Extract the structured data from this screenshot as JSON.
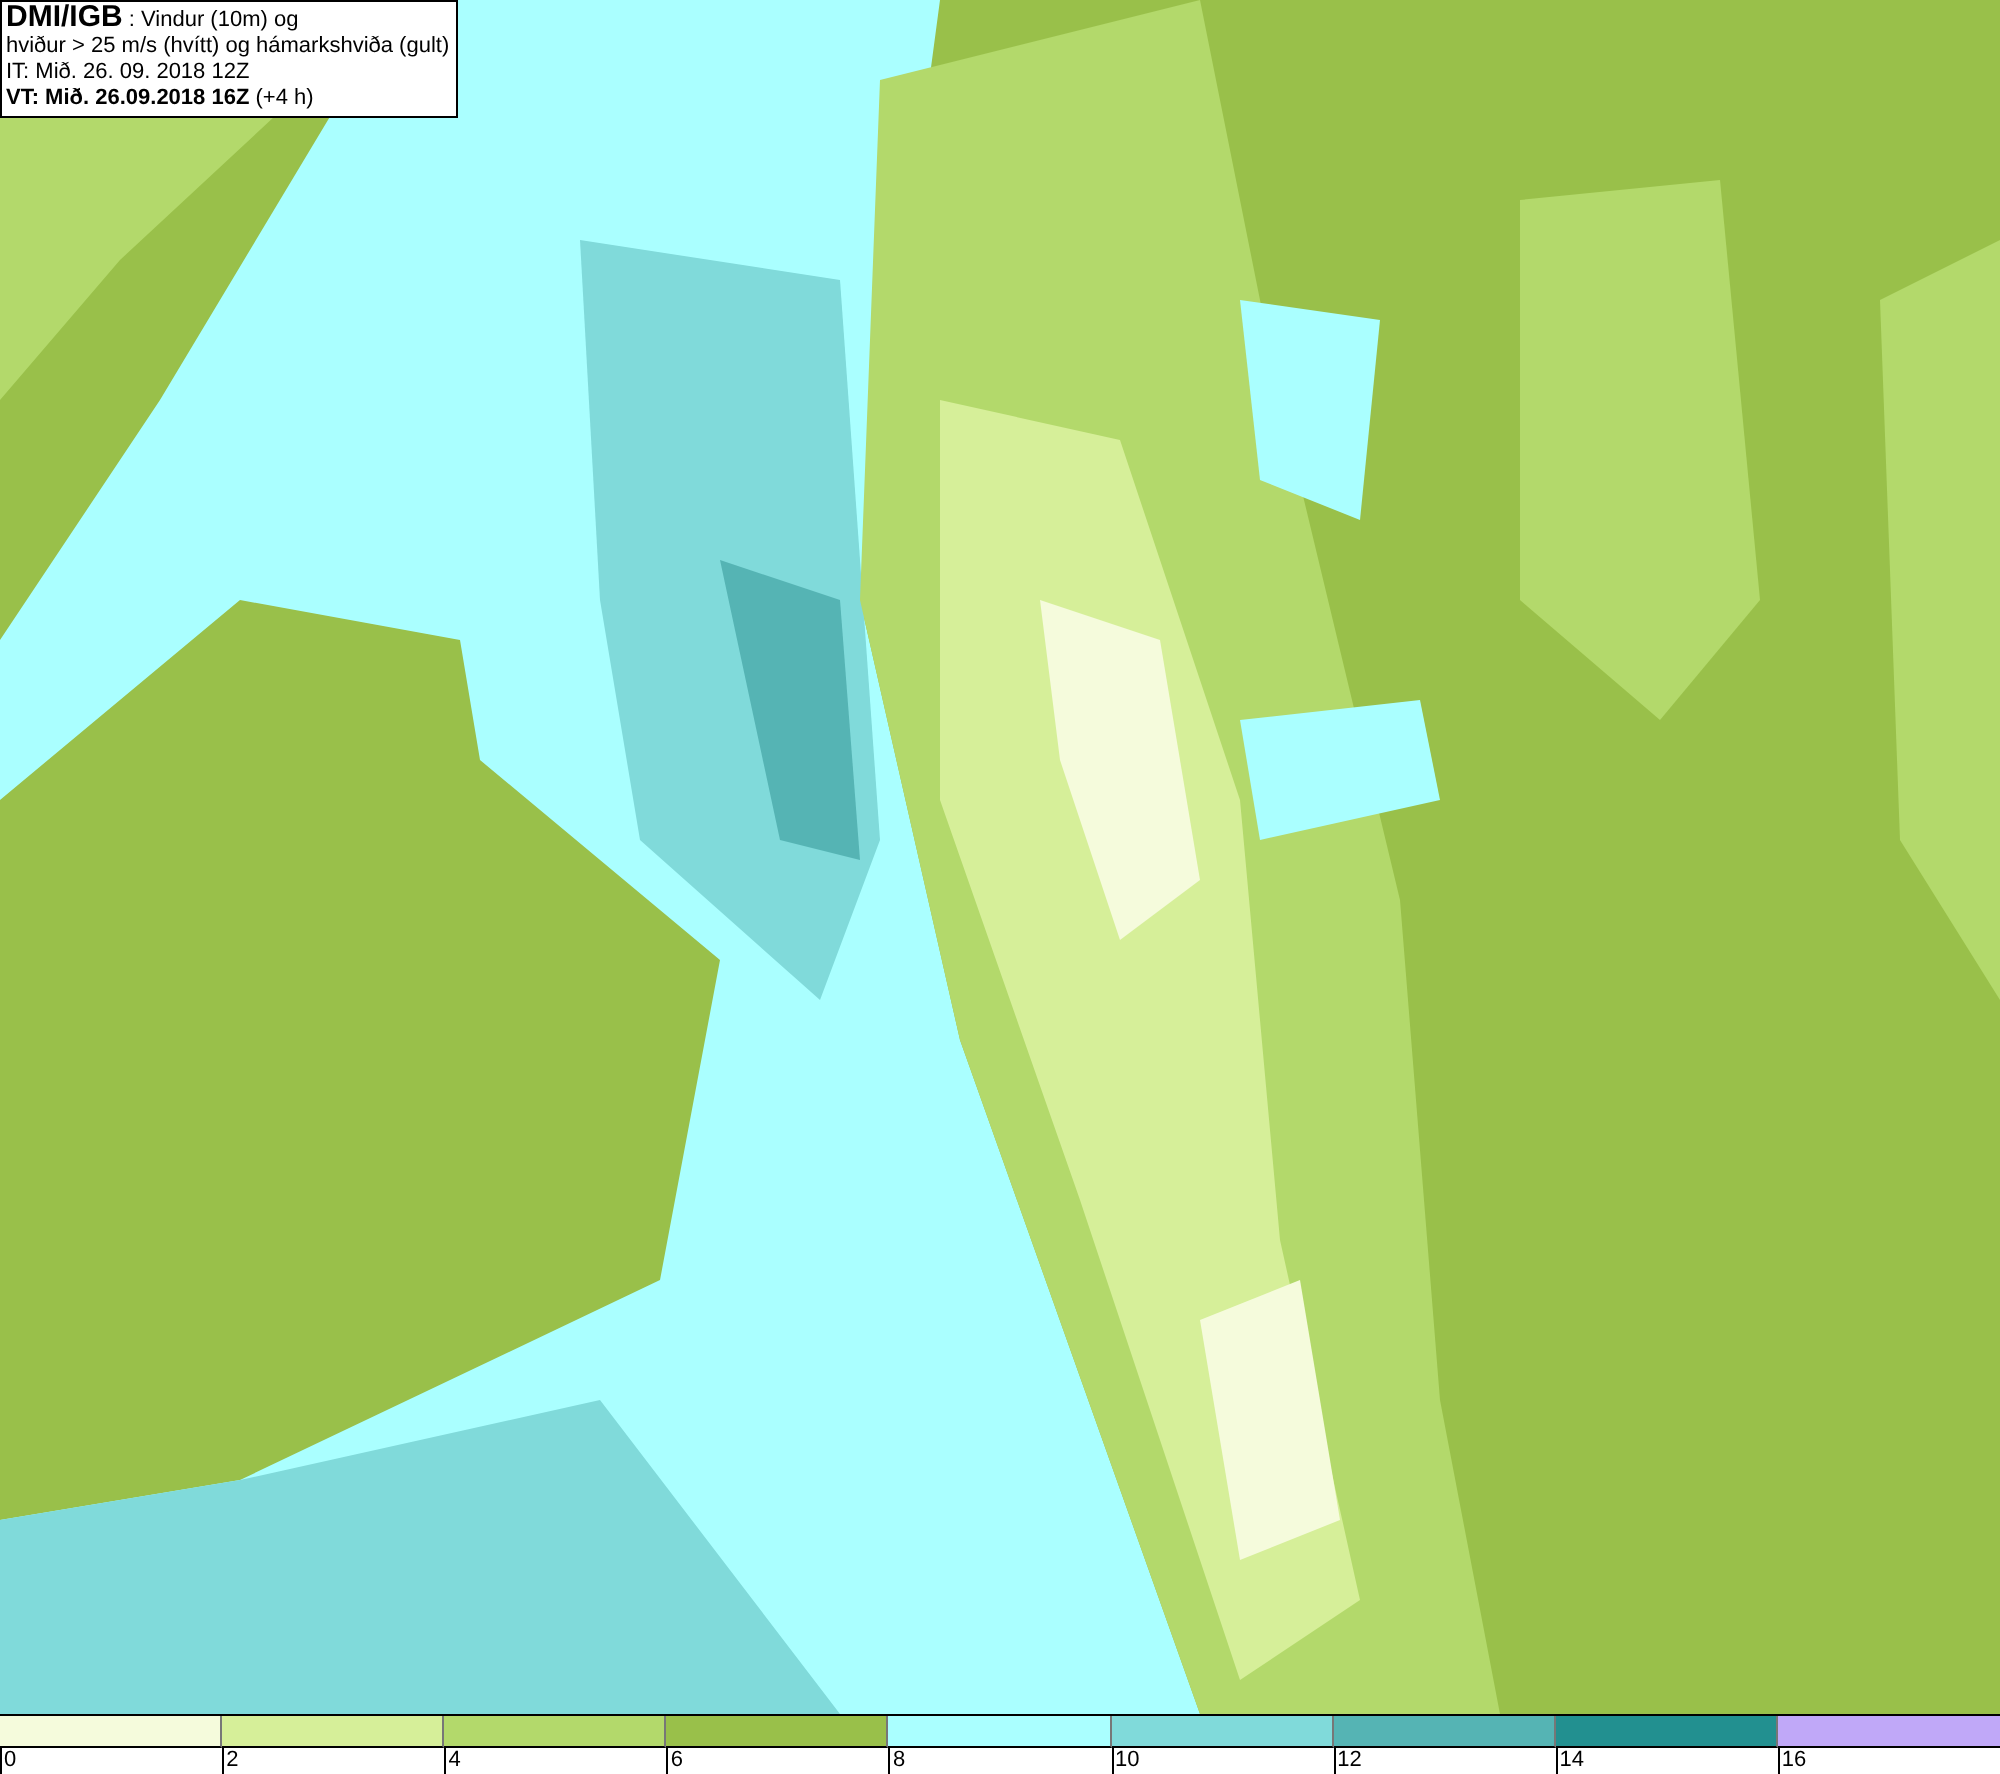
{
  "title_box": {
    "lines": [
      "**DMI/IGB** : Vindur (10m) og",
      "hviður > 25 m/s (hvítt) og hámarkshviða (gult)",
      "IT: Mið. 26. 09. 2018 12Z",
      "**VT: Mið. 26.09.2018 16Z** (+4 h)"
    ]
  },
  "legend": {
    "bins": [
      {
        "label": "0",
        "color": "#f5fbdc"
      },
      {
        "label": "2",
        "color": "#d6ef99"
      },
      {
        "label": "4",
        "color": "#b3d96b"
      },
      {
        "label": "6",
        "color": "#99c04a"
      },
      {
        "label": "8",
        "color": "#aaffff"
      },
      {
        "label": "10",
        "color": "#80dada"
      },
      {
        "label": "12",
        "color": "#55b4b4"
      },
      {
        "label": "14",
        "color": "#229090"
      },
      {
        "label": "16",
        "color": "#c0a8f8"
      }
    ]
  }
}
